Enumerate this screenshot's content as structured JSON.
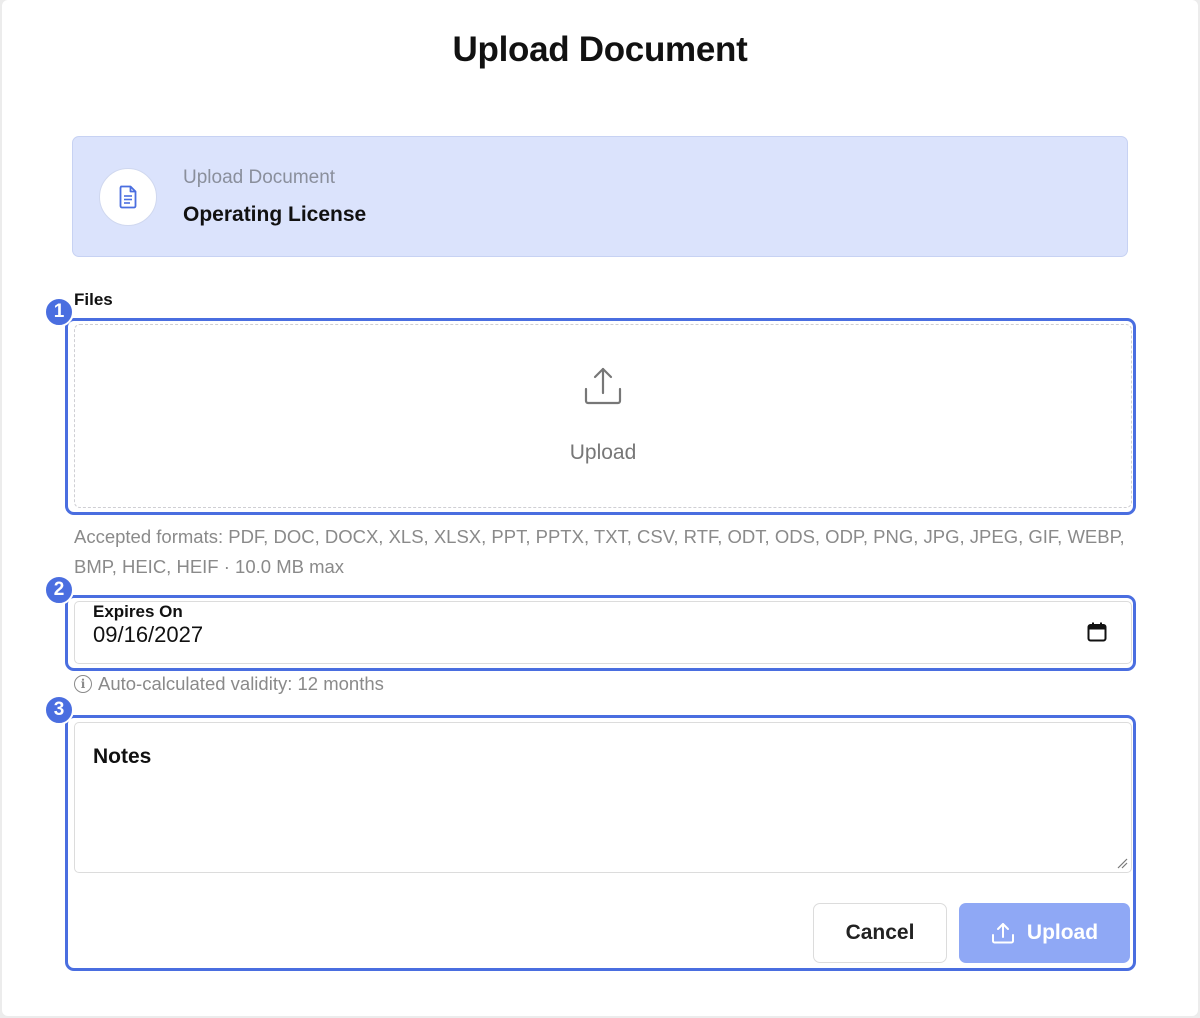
{
  "dialog": {
    "title": "Upload Document"
  },
  "document": {
    "subtitle": "Upload Document",
    "name": "Operating License"
  },
  "files": {
    "label": "Files",
    "dropzone_text": "Upload",
    "accepted_formats": "Accepted formats: PDF, DOC, DOCX, XLS, XLSX, PPT, PPTX, TXT, CSV, RTF, ODT, ODS, ODP, PNG, JPG, JPEG, GIF, WEBP, BMP, HEIC, HEIF · 10.0 MB max"
  },
  "expires": {
    "label": "Expires On",
    "value": "09/16/2027",
    "validity_note": "Auto-calculated validity: 12 months"
  },
  "notes": {
    "label": "Notes"
  },
  "actions": {
    "cancel_label": "Cancel",
    "upload_label": "Upload"
  },
  "annotations": {
    "badge1": "1",
    "badge2": "2",
    "badge3": "3"
  },
  "colors": {
    "accent": "#4a6ee0",
    "card_bg": "#dbe3fc",
    "upload_button": "#8fa8f5"
  },
  "icons": {
    "document": "document-icon",
    "upload": "upload-icon",
    "calendar": "calendar-icon",
    "info": "info-icon",
    "resize": "resize-handle-icon"
  }
}
